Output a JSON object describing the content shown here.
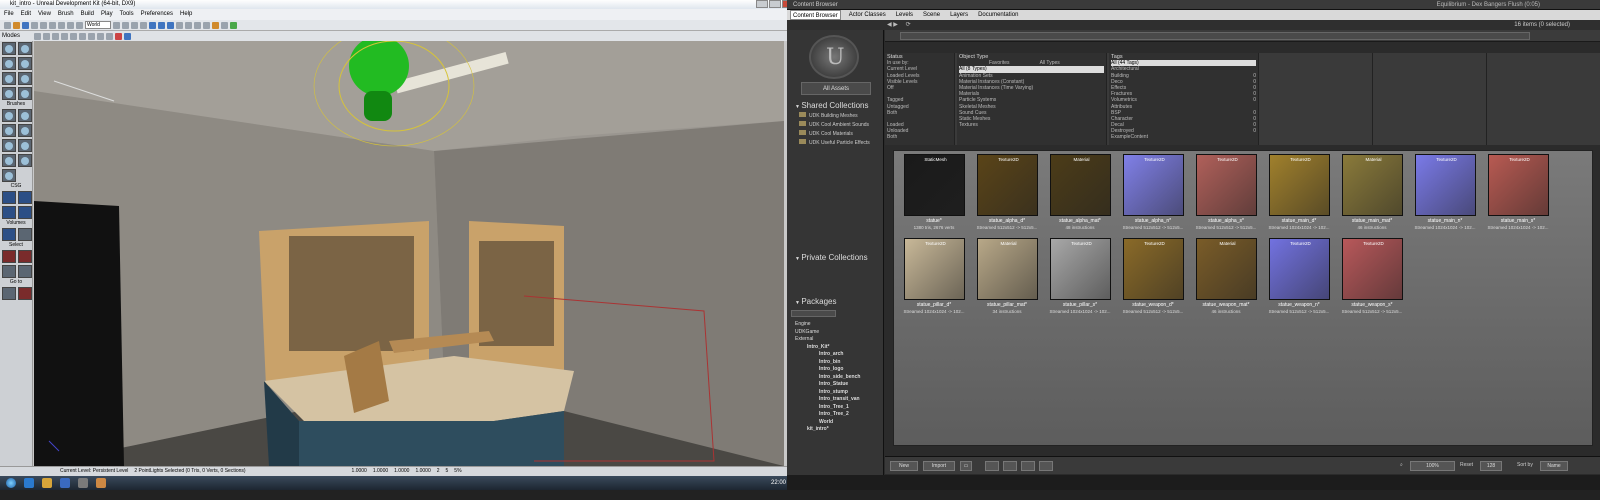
{
  "udk": {
    "title": "kit_intro - Unreal Development Kit (64-bit, DX9)",
    "menu": [
      "File",
      "Edit",
      "View",
      "Brush",
      "Build",
      "Play",
      "Tools",
      "Preferences",
      "Help"
    ],
    "coord_combo": "World",
    "modes_label": "Modes",
    "sections": [
      "Brushes",
      "CSG",
      "Volumes",
      "Select",
      "Go to"
    ],
    "status": {
      "level": "Current Level: Persistent Level",
      "selection": "2 PointLights Selected (0 Tris, 0 Verts, 0 Sections)",
      "drag_grid": "1.0000",
      "grid2": "1.0000",
      "grid3": "1.0000",
      "grid4": "1.0000",
      "snap": "2",
      "angle": "5",
      "scale": "5%"
    },
    "clock": "22:00"
  },
  "cb": {
    "title": "Content Browser",
    "player_text": "Equilibrium - Dex Bangers Flush (0:05)",
    "tabs": [
      "Content Browser",
      "Actor Classes",
      "Levels",
      "Scene",
      "Layers",
      "Documentation"
    ],
    "active_tab": "Content Browser",
    "count": "16 items (0 selected)",
    "all_assets": "All Assets",
    "shared_collections": "Shared Collections",
    "collections": [
      "UDK Building Meshes",
      "UDK Cool Ambient Sounds",
      "UDK Cool Materials",
      "UDK Useful Particle Effects"
    ],
    "private_collections": "Private Collections",
    "packages_label": "Packages",
    "packages": [
      {
        "label": "Engine",
        "level": 0
      },
      {
        "label": "UDKGame",
        "level": 0
      },
      {
        "label": "External",
        "level": 0
      },
      {
        "label": "Intro_Kit*",
        "level": 1
      },
      {
        "label": "Intro_arch",
        "level": 2
      },
      {
        "label": "Intro_bin",
        "level": 2
      },
      {
        "label": "Intro_logo",
        "level": 2
      },
      {
        "label": "Intro_side_bench",
        "level": 2
      },
      {
        "label": "Intro_Statue",
        "level": 2
      },
      {
        "label": "Intro_stump",
        "level": 2
      },
      {
        "label": "Intro_transit_van",
        "level": 2
      },
      {
        "label": "Intro_Tree_1",
        "level": 2
      },
      {
        "label": "Intro_Tree_2",
        "level": 2
      },
      {
        "label": "World",
        "level": 2
      },
      {
        "label": "kit_intro*",
        "level": 1
      }
    ],
    "filters": {
      "status_h": "Status",
      "status_items": [
        "In use by:",
        "Current Level",
        "Loaded Levels",
        "Visible Levels",
        "Off",
        "",
        "Tagged",
        "Untagged",
        "Both",
        "",
        "Loaded",
        "Unloaded",
        "Both"
      ],
      "object_type_h": "Object Type",
      "favorites": "Favorites",
      "all_types_btn": "All Types",
      "object_types": [
        "All (8 Types)",
        "Animation Sets",
        "Material Instances (Constant)",
        "Material Instances (Time Varying)",
        "Materials",
        "Particle Systems",
        "Skeletal Meshes",
        "Sound Cues",
        "Static Meshes",
        "Textures"
      ],
      "tags_h": "Tags",
      "tags": [
        "All (44 Tags)",
        "Architectural",
        "Building",
        "Deco",
        "Effects",
        "Fractures",
        "Volumetrics",
        "Attributes",
        "BSP",
        "Character",
        "Decal",
        "Destroyed",
        "ExampleContent"
      ],
      "tag_counts": [
        "",
        "",
        "0",
        "0",
        "0",
        "0",
        "0",
        "",
        "0",
        "0",
        "0",
        "0",
        ""
      ]
    },
    "assets": [
      {
        "type": "StaticMesh",
        "name": "statue*",
        "info": "1380 tris, 2676 verts",
        "color": "#1a1a1a"
      },
      {
        "type": "Texture2D",
        "name": "statue_alpha_d*",
        "info": "Streamed 512x512 -> 512x5...",
        "color": "#5a4418"
      },
      {
        "type": "Material",
        "name": "statue_alpha_mat*",
        "info": "48 instructions",
        "color": "#4c3c18"
      },
      {
        "type": "Texture2D",
        "name": "statue_alpha_n*",
        "info": "Streamed 512x512 -> 512x5...",
        "color": "#8080e8"
      },
      {
        "type": "Texture2D",
        "name": "statue_alpha_s*",
        "info": "Streamed 512x512 -> 512x5...",
        "color": "#b0605a"
      },
      {
        "type": "Texture2D",
        "name": "statue_main_d*",
        "info": "Streamed 1024x1024 -> 102...",
        "color": "#a0802c"
      },
      {
        "type": "Material",
        "name": "statue_main_mat*",
        "info": "46 instructions",
        "color": "#8a7a3a"
      },
      {
        "type": "Texture2D",
        "name": "statue_main_n*",
        "info": "Streamed 1024x1024 -> 102...",
        "color": "#7a7ae8"
      },
      {
        "type": "Texture2D",
        "name": "statue_main_s*",
        "info": "Streamed 1024x1024 -> 102...",
        "color": "#b85a52"
      },
      {
        "type": "Texture2D",
        "name": "statue_pillar_d*",
        "info": "Streamed 1024x1024 -> 102...",
        "color": "#c8b898"
      },
      {
        "type": "Material",
        "name": "statue_pillar_mat*",
        "info": "34 instructions",
        "color": "#b8a888"
      },
      {
        "type": "Texture2D",
        "name": "statue_pillar_s*",
        "info": "Streamed 1024x1024 -> 102...",
        "color": "#a8a8a8"
      },
      {
        "type": "Texture2D",
        "name": "statue_weapon_d*",
        "info": "Streamed 512x512 -> 512x5...",
        "color": "#8a6a28"
      },
      {
        "type": "Material",
        "name": "statue_weapon_mat*",
        "info": "46 instructions",
        "color": "#7a5c28"
      },
      {
        "type": "Texture2D",
        "name": "statue_weapon_n*",
        "info": "Streamed 512x512 -> 512x5...",
        "color": "#7272e0"
      },
      {
        "type": "Texture2D",
        "name": "statue_weapon_s*",
        "info": "Streamed 512x512 -> 512x5...",
        "color": "#b8585a"
      }
    ],
    "bottom": {
      "new": "New",
      "import": "Import",
      "zoom": "100%",
      "reset": "Reset",
      "size": "128",
      "sort_label": "Sort by",
      "sort_value": "Name"
    }
  }
}
